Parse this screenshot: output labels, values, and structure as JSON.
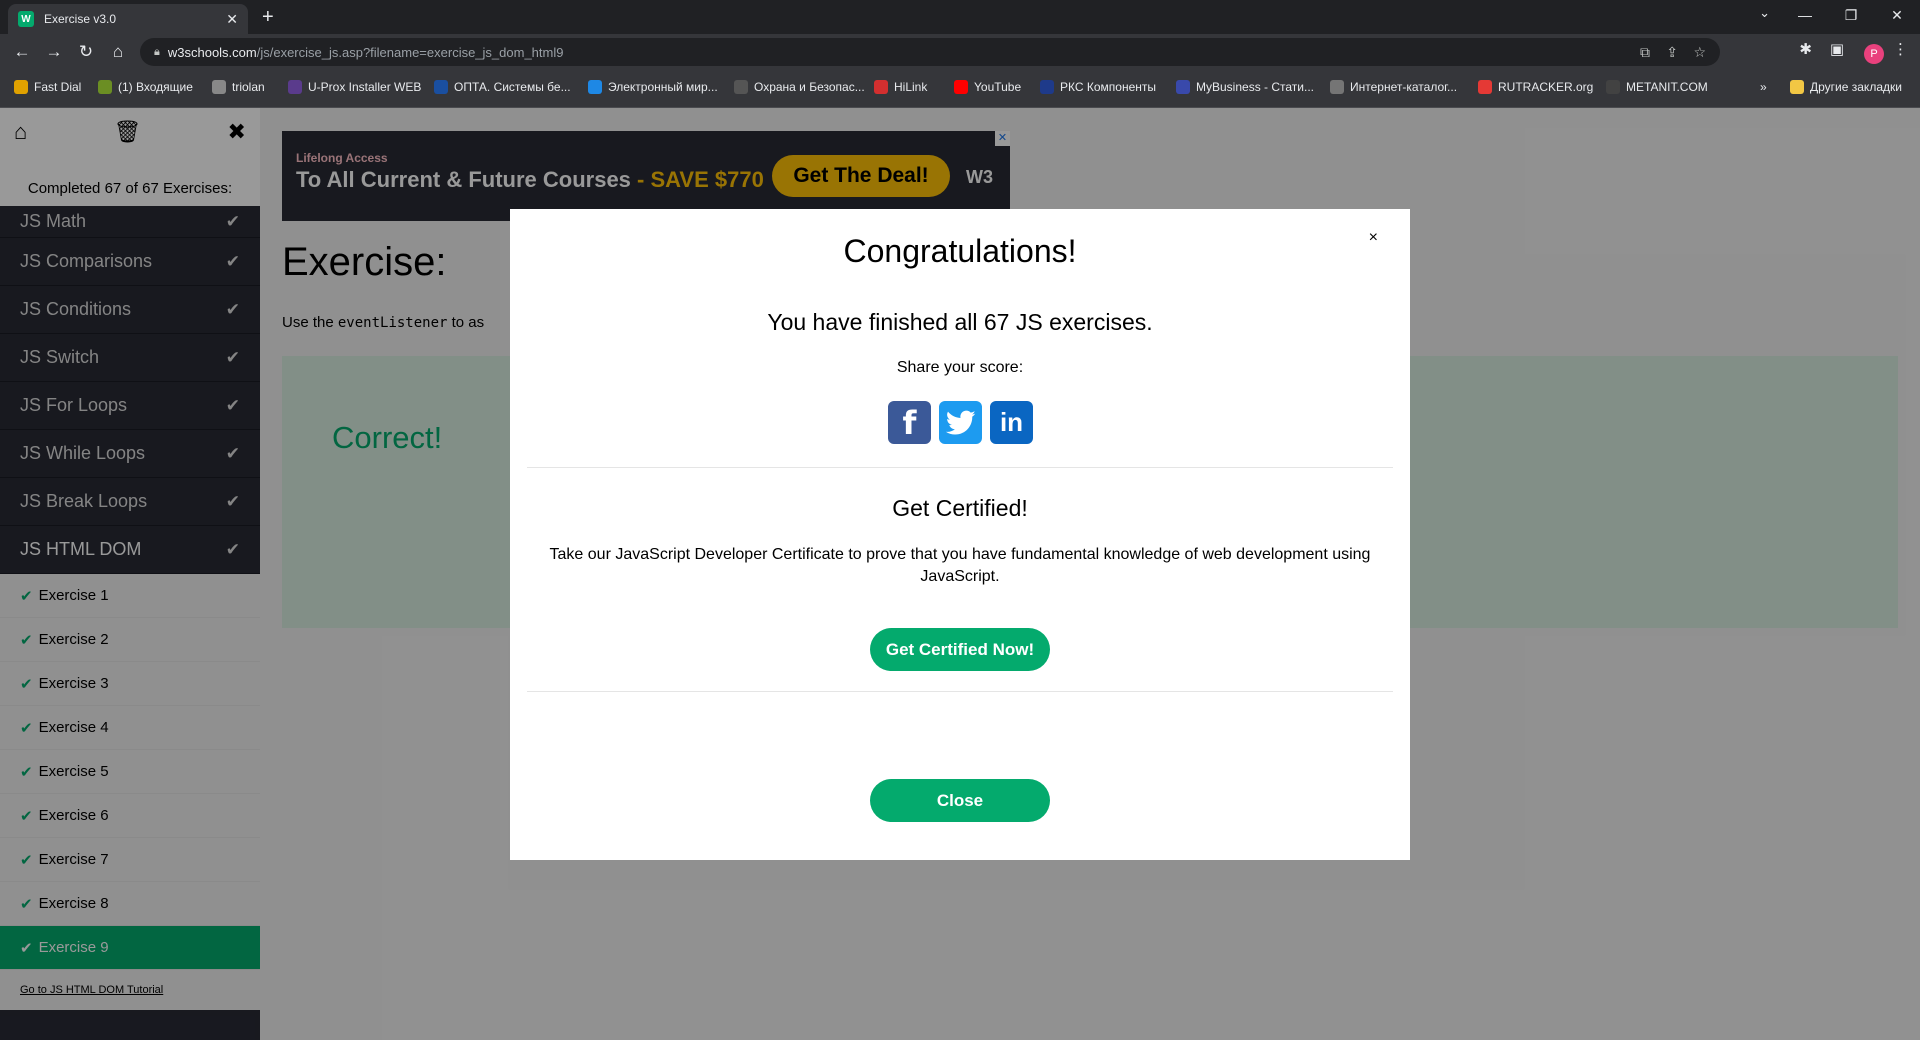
{
  "browser": {
    "tab_title": "Exercise v3.0",
    "tab_favicon": "W",
    "url_host": "w3schools.com",
    "url_path": "/js/exercise_js.asp?filename=exercise_js_dom_html9",
    "profile_initial": "P",
    "bookmarks": [
      {
        "label": "Fast Dial",
        "color": "#e0a100"
      },
      {
        "label": "(1) Входящие",
        "color": "#6b8e23"
      },
      {
        "label": "triolan",
        "color": "#888888"
      },
      {
        "label": "U-Prox Installer WEB",
        "color": "#5a3b8c"
      },
      {
        "label": "ОПТА. Системы бе...",
        "color": "#1a4fa0"
      },
      {
        "label": "Электронный мир...",
        "color": "#1e88e5"
      },
      {
        "label": "Охрана и Безопас...",
        "color": "#555555"
      },
      {
        "label": "HiLink",
        "color": "#d32f2f"
      },
      {
        "label": "YouTube",
        "color": "#ff0000"
      },
      {
        "label": "РКС Компоненты",
        "color": "#1e3a8a"
      },
      {
        "label": "MyBusiness - Стати...",
        "color": "#3949ab"
      },
      {
        "label": "Интернет-каталог...",
        "color": "#757575"
      },
      {
        "label": "RUTRACKER.org",
        "color": "#e53935"
      },
      {
        "label": "METANIT.COM",
        "color": "#424242"
      }
    ],
    "other_bookmarks": "Другие закладки"
  },
  "sidebar": {
    "completed_text": "Completed 67 of 67 Exercises:",
    "sections": [
      {
        "label": "JS Math"
      },
      {
        "label": "JS Comparisons"
      },
      {
        "label": "JS Conditions"
      },
      {
        "label": "JS Switch"
      },
      {
        "label": "JS For Loops"
      },
      {
        "label": "JS While Loops"
      },
      {
        "label": "JS Break Loops"
      },
      {
        "label": "JS HTML DOM"
      }
    ],
    "exercises": [
      "Exercise 1",
      "Exercise 2",
      "Exercise 3",
      "Exercise 4",
      "Exercise 5",
      "Exercise 6",
      "Exercise 7",
      "Exercise 8",
      "Exercise 9"
    ],
    "selected_exercise": "Exercise 9",
    "tutorial_link": "Go to JS HTML DOM Tutorial"
  },
  "ad": {
    "small_text": "Lifelong Access",
    "big_text": "To All Current & Future Courses",
    "save_text": "- SAVE $770",
    "button_label": "Get The Deal!",
    "logo": "W3"
  },
  "exercise": {
    "title": "Exercise:",
    "text_prefix": "Use the",
    "code": "eventListener",
    "text_suffix": "to as",
    "correct_label": "Correct!"
  },
  "modal": {
    "close_x": "×",
    "title": "Congratulations!",
    "finished_text": "You have finished all 67 JS exercises.",
    "share_text": "Share your score:",
    "cert_title": "Get Certified!",
    "cert_text": "Take our JavaScript Developer Certificate to prove that you have fundamental knowledge of web development using JavaScript.",
    "cert_button": "Get Certified Now!",
    "close_button": "Close"
  },
  "colors": {
    "w3_green": "#04aa6d",
    "sidebar_dark": "#282a35",
    "correct_bg": "#d9eee1"
  }
}
